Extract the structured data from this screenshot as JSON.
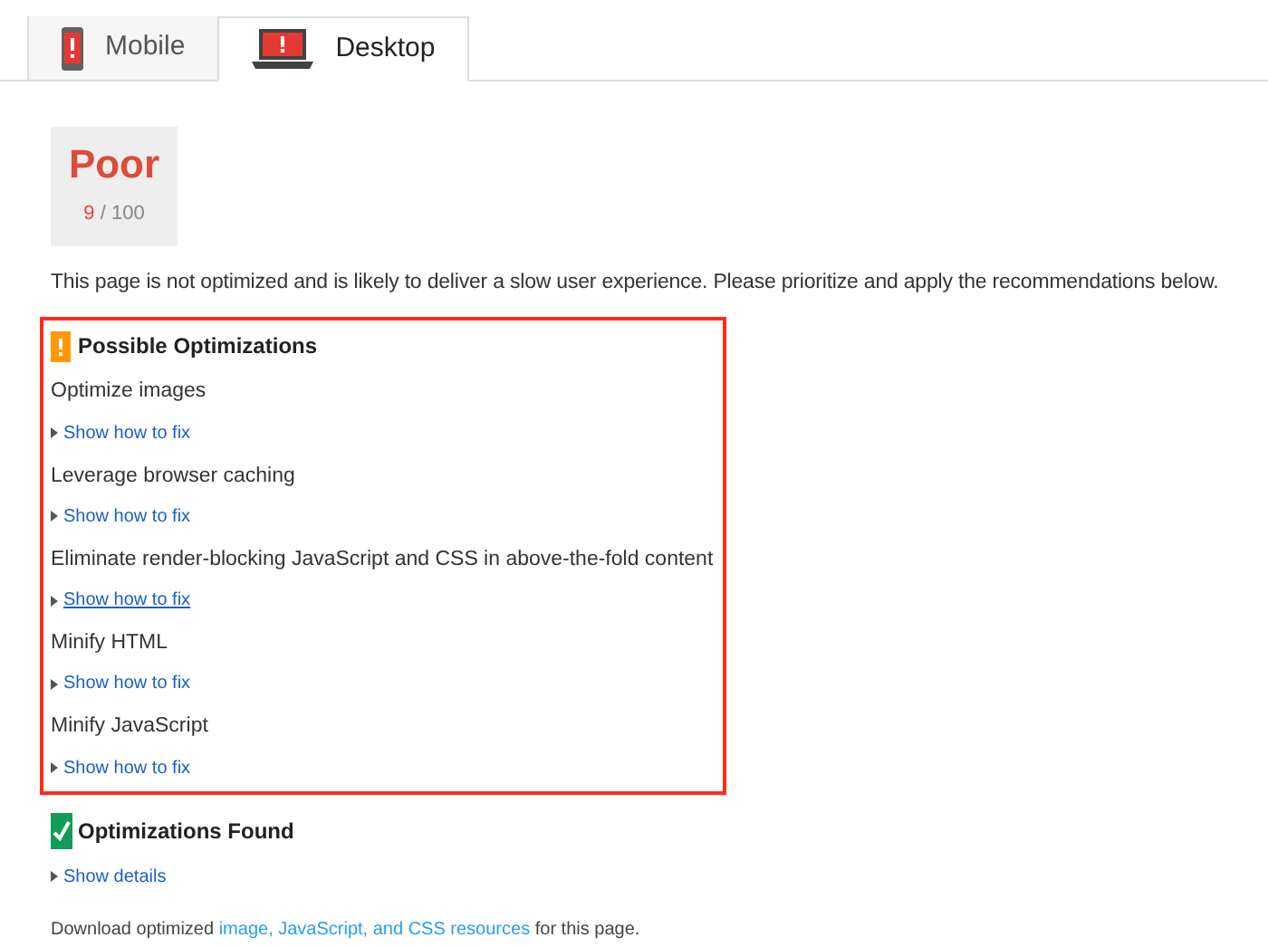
{
  "tabs": [
    {
      "label": "Mobile",
      "kind": "mobile",
      "selected": false
    },
    {
      "label": "Desktop",
      "kind": "desktop",
      "selected": true
    }
  ],
  "score": {
    "rating": "Poor",
    "value": "9",
    "max": "/ 100"
  },
  "summary": "This page is not optimized and is likely to deliver a slow user experience. Please prioritize and apply the recommendations below.",
  "possible_optimizations": {
    "title": "Possible Optimizations",
    "items": [
      {
        "title": "Optimize images",
        "link": "Show how to fix",
        "hovered": false
      },
      {
        "title": "Leverage browser caching",
        "link": "Show how to fix",
        "hovered": false
      },
      {
        "title": "Eliminate render-blocking JavaScript and CSS in above-the-fold content",
        "link": "Show how to fix",
        "hovered": true
      },
      {
        "title": "Minify HTML",
        "link": "Show how to fix",
        "hovered": false
      },
      {
        "title": "Minify JavaScript",
        "link": "Show how to fix",
        "hovered": false
      }
    ]
  },
  "optimizations_found": {
    "title": "Optimizations Found",
    "link": "Show details"
  },
  "download": {
    "before": "Download optimized ",
    "link": "image, JavaScript, and CSS resources",
    "after": " for this page."
  }
}
